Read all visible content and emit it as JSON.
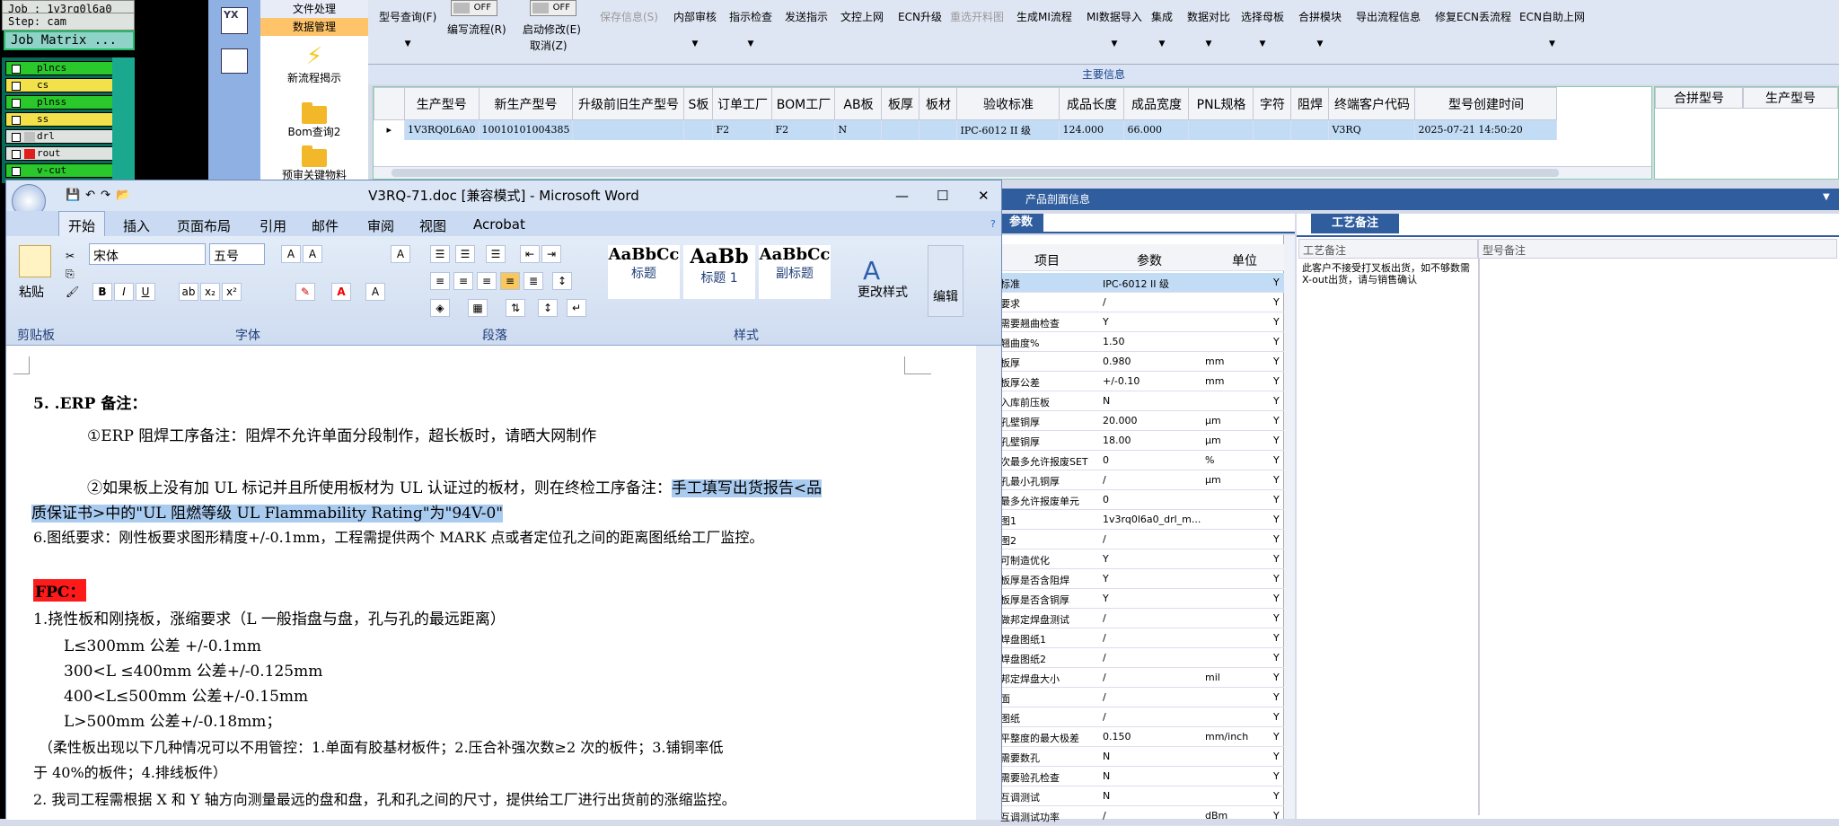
{
  "left_panel": {
    "job": "Job : 1v3rq0l6a0",
    "step": "Step: cam",
    "job_matrix": "Job Matrix ...",
    "layers": [
      {
        "name": "plncs",
        "color": "#2ac82a"
      },
      {
        "name": "cs",
        "color": "#f2e14a"
      },
      {
        "name": "plnss",
        "color": "#2ac82a"
      },
      {
        "name": "ss",
        "color": "#f2e14a"
      },
      {
        "name": "drl",
        "color": "#c0c0c0"
      },
      {
        "name": "rout",
        "color": "#e21b1b"
      },
      {
        "name": "v-cut",
        "color": "#2ac82a"
      }
    ]
  },
  "nav": {
    "file": "文件处理",
    "data": "数据管理",
    "new_flow": "新流程揭示",
    "bom": "Bom查询2",
    "pre": "预审关键物料"
  },
  "toolbar": {
    "items": [
      "型号查询(F)",
      "编写流程(R)",
      "启动修改(E)",
      "取消(Z)",
      "保存信息(S)",
      "内部审核",
      "指示检查",
      "发送指示",
      "文控上网",
      "ECN升级",
      "重选开料图",
      "生成MI流程",
      "MI数据导入",
      "集成",
      "数据对比",
      "选择母板",
      "合拼模块",
      "导出流程信息",
      "修复ECN丢流程",
      "ECN自助上网"
    ],
    "toggle": "OFF"
  },
  "main_info": {
    "title": "主要信息",
    "headers": [
      "生产型号",
      "新生产型号",
      "升级前旧生产型号",
      "S板",
      "订单工厂",
      "BOM工厂",
      "AB板",
      "板厚",
      "板材",
      "验收标准",
      "成品长度",
      "成品宽度",
      "PNL规格",
      "字符",
      "阻焊",
      "终端客户代码",
      "型号创建时间"
    ],
    "row": [
      "1V3RQ0L6A0",
      "10010101004385",
      "",
      "",
      "F2",
      "F2",
      "N",
      "",
      "",
      "IPC-6012 II 级",
      "124.000",
      "66.000",
      "",
      "",
      "",
      "V3RQ",
      "2025-07-21 14:50:20"
    ],
    "merge_headers": [
      "合拼型号",
      "生产型号"
    ]
  },
  "product": {
    "bar": "产品剖面信息",
    "tab": "参数",
    "craft_tab": "工艺备注",
    "craft_col": "工艺备注",
    "model_col": "型号备注",
    "craft_text": "此客户不接受打叉板出货，如不够数需X-out出货，请与销售确认",
    "headers": [
      "项目",
      "参数",
      "单位"
    ],
    "rows": [
      [
        "标准",
        "IPC-6012 II 级",
        ""
      ],
      [
        "要求",
        "/",
        ""
      ],
      [
        "需要翘曲检查",
        "Y",
        ""
      ],
      [
        "翘曲度%",
        "1.50",
        ""
      ],
      [
        "板厚",
        "0.980",
        "mm"
      ],
      [
        "板厚公差",
        "+/-0.10",
        "mm"
      ],
      [
        "入库前压板",
        "N",
        ""
      ],
      [
        "孔壁铜厚",
        "20.000",
        "μm"
      ],
      [
        "孔壁铜厚",
        "18.00",
        "μm"
      ],
      [
        "次最多允许报废SET",
        "0",
        "%"
      ],
      [
        "孔最小孔铜厚",
        "/",
        "μm"
      ],
      [
        "最多允许报废单元",
        "0",
        ""
      ],
      [
        "图1",
        "1v3rq0l6a0_drl_m...",
        ""
      ],
      [
        "图2",
        "/",
        ""
      ],
      [
        "可制造优化",
        "Y",
        ""
      ],
      [
        "板厚是否含阻焊",
        "Y",
        ""
      ],
      [
        "板厚是否含铜厚",
        "Y",
        ""
      ],
      [
        "做邦定焊盘测试",
        "/",
        ""
      ],
      [
        "焊盘图纸1",
        "/",
        ""
      ],
      [
        "焊盘图纸2",
        "/",
        ""
      ],
      [
        "邦定焊盘大小",
        "/",
        "mil"
      ],
      [
        "面",
        "/",
        ""
      ],
      [
        "图纸",
        "/",
        ""
      ],
      [
        "平整度的最大极差",
        "0.150",
        "mm/inch"
      ],
      [
        "需要数孔",
        "N",
        ""
      ],
      [
        "需要验孔检查",
        "N",
        ""
      ],
      [
        "互调测试",
        "N",
        ""
      ],
      [
        "互调测试功率",
        "/",
        "dBm"
      ]
    ]
  },
  "word": {
    "title": "V3RQ-71.doc [兼容模式] - Microsoft Word",
    "tabs": [
      "开始",
      "插入",
      "页面布局",
      "引用",
      "邮件",
      "审阅",
      "视图",
      "Acrobat"
    ],
    "font": "宋体",
    "size": "五号",
    "groups": [
      "剪贴板",
      "字体",
      "段落",
      "样式",
      "编辑"
    ],
    "paste": "粘贴",
    "more_styles": "更改样式",
    "styles": [
      {
        "sample": "AaBbCc",
        "name": "标题"
      },
      {
        "sample": "AaBb",
        "name": "标题 1"
      },
      {
        "sample": "AaBbCc",
        "name": "副标题"
      }
    ],
    "lines": [
      "5. .ERP 备注：",
      "①ERP 阻焊工序备注：阻焊不允许单面分段制作，超长板时，请晒大网制作",
      "②如果板上没有加 UL 标记并且所使用板材为 UL 认证过的板材，则在终检工序备注：",
      "手工填写出货报告<品",
      "质保证书>中的\"UL 阻燃等级 UL Flammability Rating\"为\"94V-0\"",
      "6.图纸要求：刚性板要求图形精度+/-0.1mm，工程需提供两个 MARK 点或者定位孔之间的距离图纸给工厂监控。",
      "FPC：",
      "1.挠性板和刚挠板，涨缩要求（L 一般指盘与盘，孔与孔的最远距离）",
      "L≤300mm 公差 +/-0.1mm",
      "300<L ≤400mm 公差+/-0.125mm",
      "400<L≤500mm 公差+/-0.15mm",
      "L>500mm 公差+/-0.18mm；",
      "（柔性板出现以下几种情况可以不用管控：1.单面有胶基材板件；2.压合补强次数≥2 次的板件；3.铺铜率低",
      "于 40%的板件；4.排线板件）",
      "2. 我司工程需根据 X 和 Y 轴方向测量最远的盘和盘，孔和孔之间的尺寸，提供给工厂进行出货前的涨缩监控。"
    ]
  }
}
